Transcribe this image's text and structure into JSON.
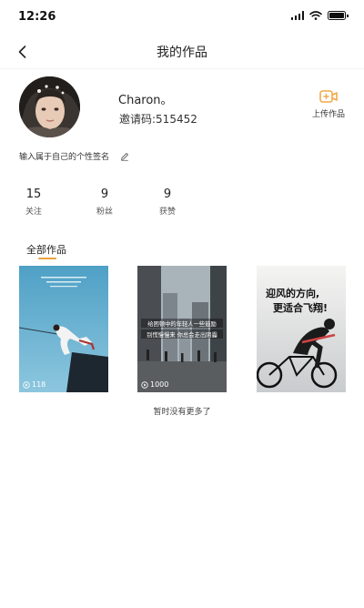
{
  "status_bar": {
    "time": "12:26"
  },
  "nav": {
    "title": "我的作品"
  },
  "profile": {
    "name": "Charon。",
    "invite_code": "邀请码:515452",
    "upload_label": "上传作品",
    "signature_placeholder": "输入属于自己的个性签名"
  },
  "stats": [
    {
      "value": "15",
      "label": "关注"
    },
    {
      "value": "9",
      "label": "粉丝"
    },
    {
      "value": "9",
      "label": "获赞"
    }
  ],
  "tabs": {
    "all_works": "全部作品"
  },
  "works": [
    {
      "play_count": "118"
    },
    {
      "play_count": "1000",
      "caption_line1": "给困顿中的年轻人一些鼓励",
      "caption_line2": "别慌慢慢来 你总会走出阴霾"
    },
    {
      "caption_line1": "迎风的方向,",
      "caption_line2": "更适合飞翔!"
    }
  ],
  "footer": {
    "no_more": "暂时没有更多了"
  },
  "colors": {
    "accent": "#e8a33a",
    "upload_icon": "#f0a94a"
  }
}
